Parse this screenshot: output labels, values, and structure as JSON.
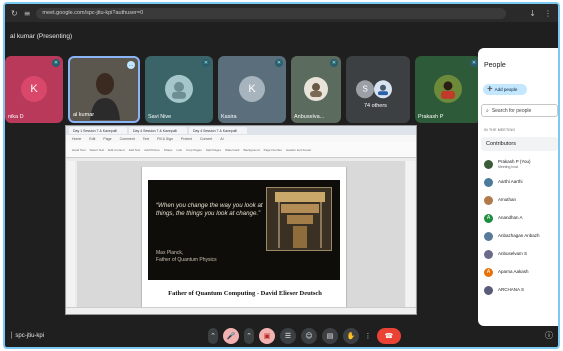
{
  "browser": {
    "url": "meet.google.com/spc-jtiu-kpi?authuser=0",
    "reload_icon": "reload-icon",
    "settings_icon": "tune-icon"
  },
  "header": {
    "presenting": "al kumar (Presenting)"
  },
  "tiles": [
    {
      "name": "nika D",
      "initial": "K",
      "color": "#d9486a",
      "bg": "#b8395a"
    },
    {
      "name": "al kumar",
      "initial": "",
      "color": "#6a6256",
      "bg": "#5c574e"
    },
    {
      "name": "Savi Nive",
      "initial": "",
      "color": "#4a7a7e",
      "bg": "#3a6468"
    },
    {
      "name": "Kasira",
      "initial": "K",
      "color": "#a7b3bd",
      "bg": "#5a6e7c"
    },
    {
      "name": "Anbuselva...",
      "initial": "",
      "color": "#7a6a54",
      "bg": "#5b6b5e"
    },
    {
      "name": "74 others",
      "initial": "S",
      "color": "#9aa0a6",
      "bg": "#3c4043"
    },
    {
      "name": "Prakash P",
      "initial": "",
      "color": "#6d8a3a",
      "bg": "#2d5a38"
    }
  ],
  "screen": {
    "tabs": [
      "Day 1 Session 7 & Kavepulli",
      "Day 4 Session 7 & Kavepulli",
      "Day 4 Session 7 & Kavepulli"
    ],
    "menu": [
      "Home",
      "Edit",
      "Page",
      "Comment",
      "Text",
      "Fill & Sign",
      "Protect",
      "Convert",
      "AI"
    ],
    "ribbon": [
      "Hand Tool",
      "Select Text",
      "Edit Content",
      "Add Text",
      "Add Picture",
      "Shape",
      "Link",
      "Crop Pages",
      "Split Pages",
      "Watermark",
      "Background",
      "Page Number",
      "Header and Footer"
    ],
    "slide_quote": "“When you change the way you look at things, the things you look at change.”",
    "slide_author": "Max Planck,",
    "slide_author_title": "Father of Quantum Physics",
    "heading": "Father of Quantum Computing - David Elieser Deutsch"
  },
  "bottom": {
    "meeting_code": "spc-jtiu-kpi",
    "controls": [
      "mic-off-icon",
      "more-icon",
      "camera-off-icon",
      "captions-icon",
      "emoji-icon",
      "present-icon",
      "raise-hand-icon",
      "more-options-icon"
    ],
    "hangup_icon": "hangup-icon",
    "info_icon": "info-icon"
  },
  "people_panel": {
    "title": "People",
    "add_people": "Add people",
    "search_placeholder": "Search for people",
    "in_meeting": "IN THE MEETING",
    "contributors": "Contributors",
    "people": [
      {
        "name": "Prakash P (You)",
        "sub": "Meeting host",
        "initial": "",
        "color": "#3b5a3a"
      },
      {
        "name": "Aarthi Aarthi",
        "sub": "",
        "initial": "",
        "color": "#4b7a9a"
      },
      {
        "name": "Amuthan",
        "sub": "",
        "initial": "",
        "color": "#b07a4a"
      },
      {
        "name": "Anandhan A",
        "sub": "",
        "initial": "A",
        "color": "#1e8e3e"
      },
      {
        "name": "Anbazhagan Anbazh",
        "sub": "",
        "initial": "",
        "color": "#5a7a9a"
      },
      {
        "name": "Anbuselvam S",
        "sub": "",
        "initial": "",
        "color": "#6a6a8a"
      },
      {
        "name": "Aparna Aakash",
        "sub": "",
        "initial": "A",
        "color": "#e8710a"
      },
      {
        "name": "ARCHANA S",
        "sub": "",
        "initial": "",
        "color": "#5a5a7a"
      }
    ]
  }
}
